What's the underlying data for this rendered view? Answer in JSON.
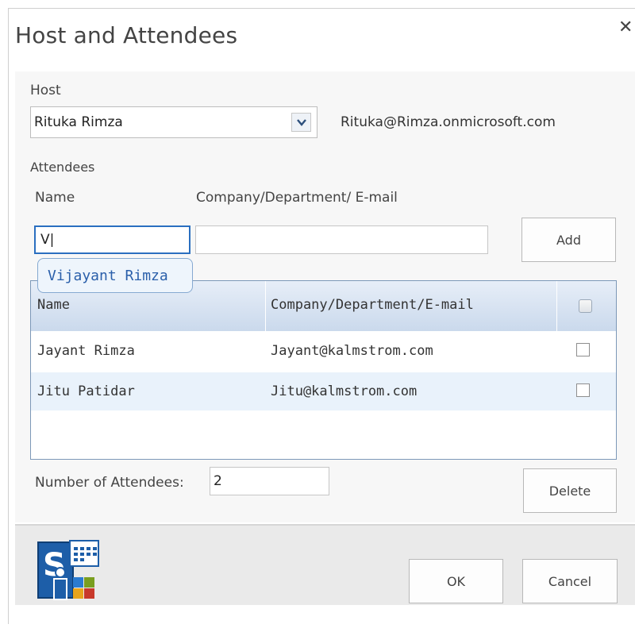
{
  "dialog": {
    "title": "Host and Attendees",
    "close_glyph": "✕"
  },
  "host": {
    "label": "Host",
    "selected": "Rituka  Rimza",
    "email": "Rituka@Rimza.onmicrosoft.com"
  },
  "attendees": {
    "section_label": "Attendees",
    "name_label": "Name",
    "company_label": "Company/Department/ E-mail",
    "name_value": "V|",
    "company_value": "",
    "add_label": "Add",
    "suggestion": "Vijayant Rimza"
  },
  "table": {
    "columns": [
      "Name",
      "Company/Department/E-mail"
    ],
    "rows": [
      {
        "name": "Jayant Rimza",
        "email": "Jayant@kalmstrom.com"
      },
      {
        "name": "Jitu Patidar",
        "email": "Jitu@kalmstrom.com"
      }
    ]
  },
  "count": {
    "label": "Number of Attendees:",
    "value": "2"
  },
  "delete_label": "Delete",
  "ok_label": "OK",
  "cancel_label": "Cancel",
  "icons": {
    "close": "close-icon",
    "dropdown": "chevron-down-icon",
    "logo": "app-logo-icon"
  },
  "colors": {
    "accent": "#2b6fc0",
    "header_gradient_top": "#e7eef8",
    "header_gradient_bottom": "#cad9ec",
    "alt_row": "#e9f2fb"
  }
}
